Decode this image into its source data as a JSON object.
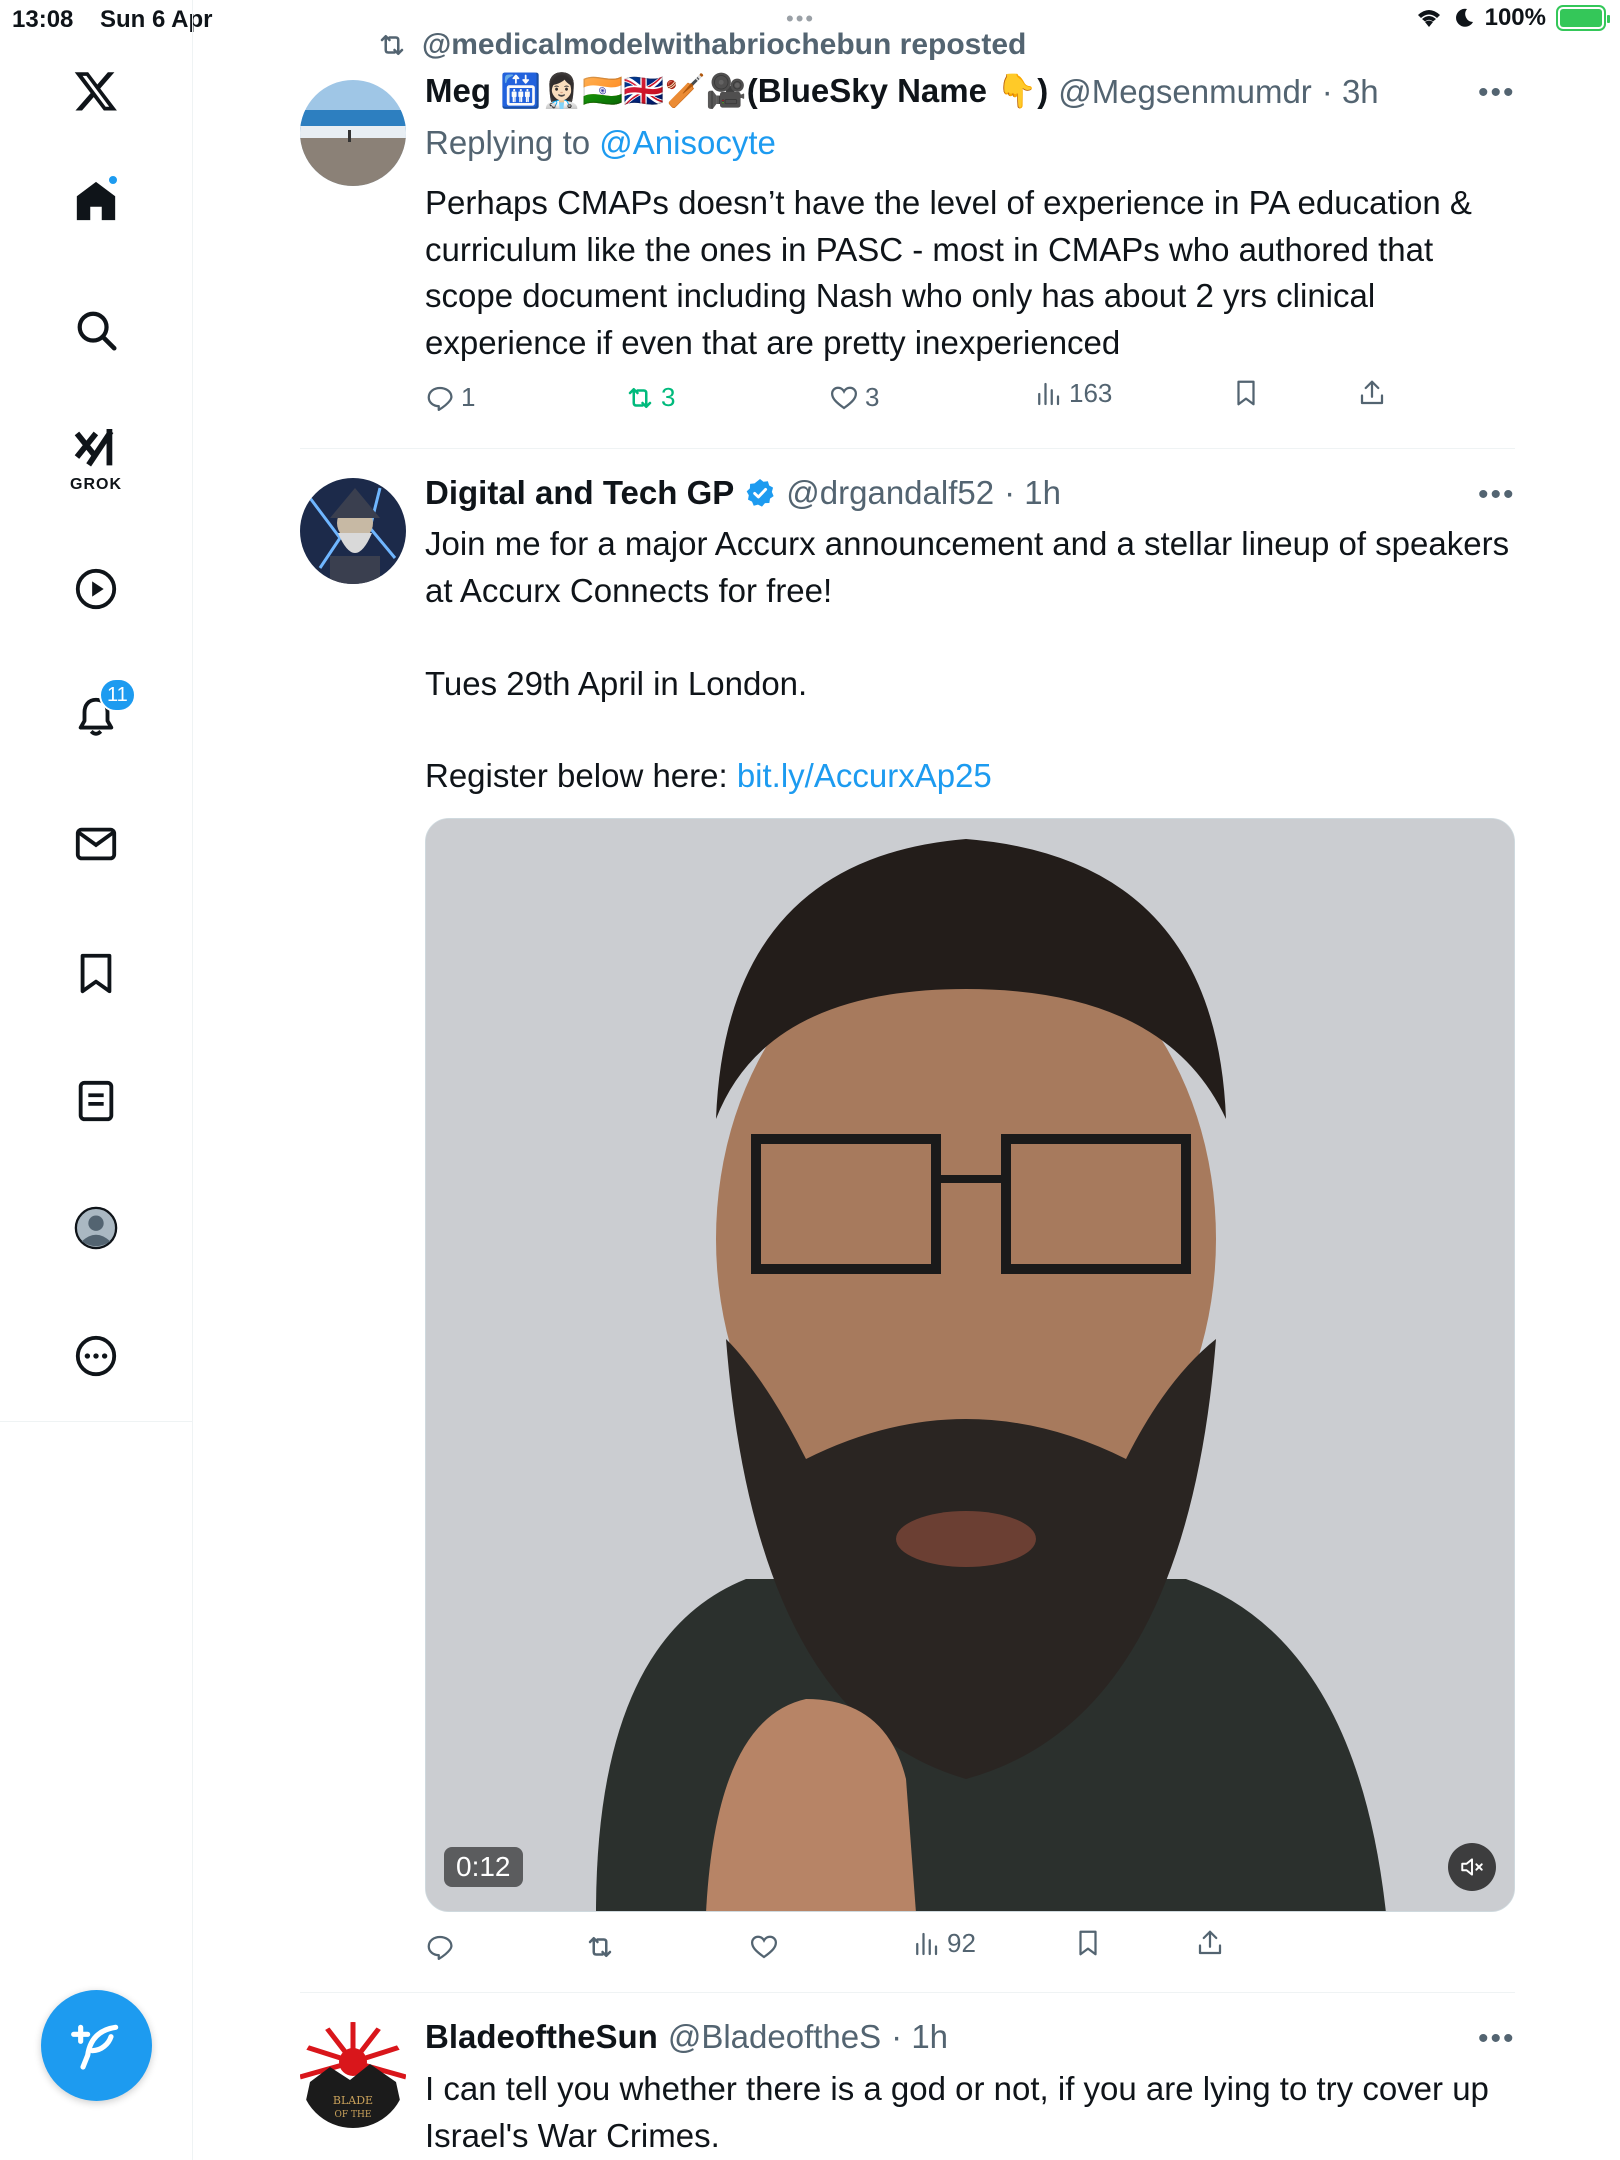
{
  "status_bar": {
    "time": "13:08",
    "date": "Sun 6 Apr",
    "battery": "100%"
  },
  "sidebar": {
    "grok_label": "GROK",
    "notifications_count": "11",
    "items": [
      "home",
      "explore",
      "grok",
      "videos",
      "notifications",
      "messages",
      "bookmarks",
      "lists",
      "profile",
      "more"
    ]
  },
  "tweets": [
    {
      "repost_by": "@medicalmodelwithabriochebun reposted",
      "name": "Meg 🛗👩🏻‍⚕️🇮🇳🇬🇧🏏🎥(BlueSky Name 👇)",
      "handle": "@Megsenmumdr",
      "time": "· 3h",
      "replying_prefix": "Replying to ",
      "replying_to": "@Anisocyte",
      "text": "Perhaps CMAPs doesn’t have the level of experience in PA education & curriculum like the ones in PASC - most in CMAPs who authored that scope document including Nash who only has about 2 yrs clinical experience if even that are pretty inexperienced",
      "replies": "1",
      "reposts": "3",
      "likes": "3",
      "views": "163"
    },
    {
      "name": "Digital and Tech GP",
      "handle": "@drgandalf52",
      "time": "· 1h",
      "text_1": "Join me for a major Accurx announcement and a stellar lineup of speakers at Accurx Connects for free!",
      "text_2": "Tues 29th April in London.",
      "text_3_prefix": "Register below here: ",
      "text_3_link": "bit.ly/AccurxAp25",
      "video_time": "0:12",
      "views": "92"
    },
    {
      "name": "BladeoftheSun",
      "handle": "@BladeoftheS",
      "time": "· 1h",
      "avatar_text": "BLADE OF THE",
      "text": "I can tell you whether there is a god or not, if you are lying to try cover up Israel's War Crimes."
    }
  ],
  "colors": {
    "accent": "#1d9bf0",
    "repost_green": "#00ba7c",
    "secondary_text": "#536471"
  }
}
